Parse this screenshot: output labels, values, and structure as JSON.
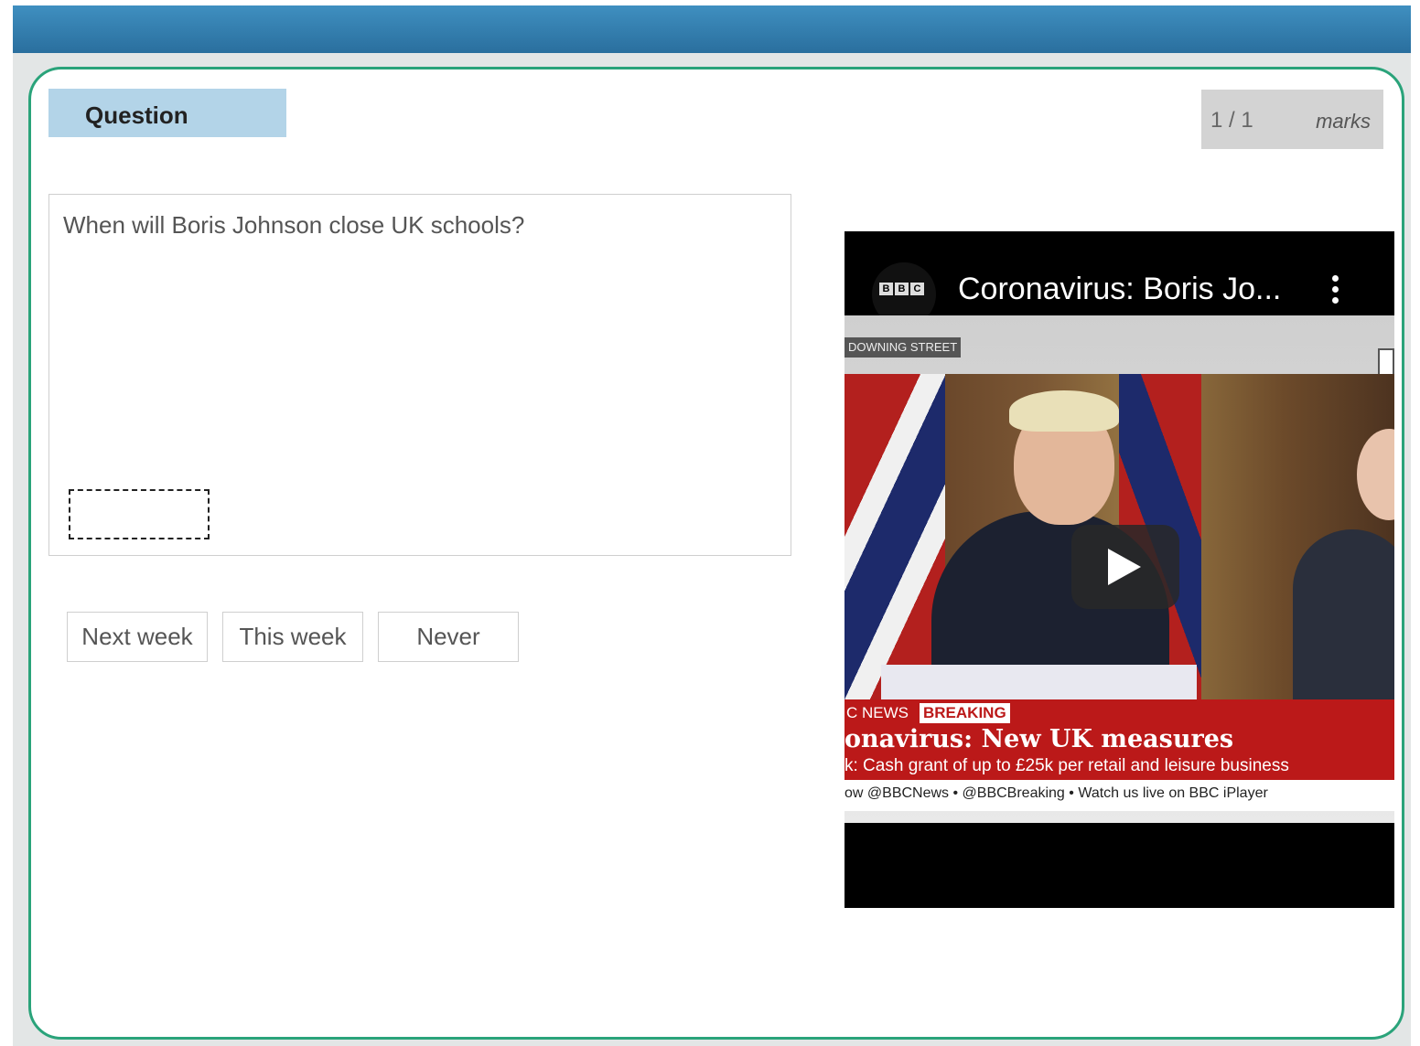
{
  "question": {
    "tab_label": "Question",
    "marks_score": "1 / 1",
    "marks_label": "marks",
    "text": "When will Boris Johnson close UK schools?",
    "options": [
      "Next week",
      "This week",
      "Never"
    ]
  },
  "video": {
    "channel_logo": [
      "B",
      "B",
      "C"
    ],
    "title": "Coronavirus: Boris Jo...",
    "location_tag": "DOWNING STREET",
    "news_tag": "C NEWS",
    "breaking_tag": "BREAKING",
    "headline": "onavirus: New UK measures",
    "subline": "k: Cash grant of up to £25k per retail and leisure business",
    "ticker": "ow @BBCNews  • @BBCBreaking  • Watch us live on BBC iPlayer"
  },
  "colors": {
    "accent_border": "#2aa37a",
    "tab_background": "#b3d4e8",
    "topbar": "#3f8fc0",
    "news_red": "#bb1919"
  }
}
